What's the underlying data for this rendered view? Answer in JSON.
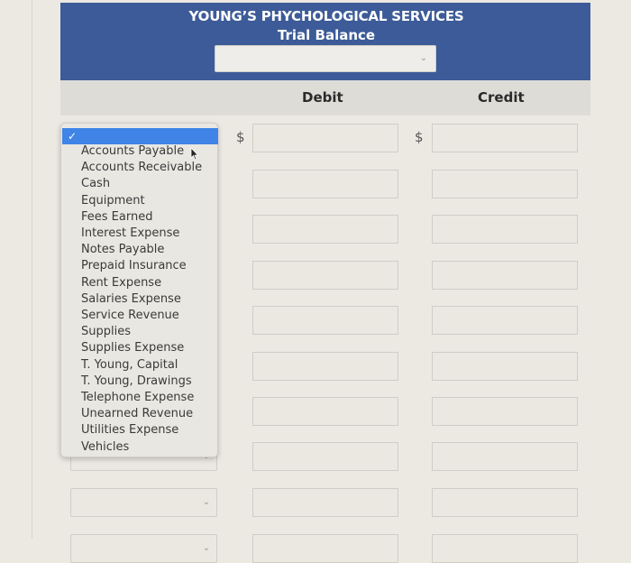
{
  "header": {
    "title": "YOUNG’S PHYCHOLOGICAL SERVICES",
    "subtitle": "Trial Balance",
    "date_select": {
      "value": "",
      "icon": "chevron-down-icon"
    },
    "background_color": "#3c5b98"
  },
  "columns": {
    "debit": "Debit",
    "credit": "Credit"
  },
  "currency_symbol": "$",
  "dropdown": {
    "open": true,
    "selected_label": "",
    "selected_icon": "checkmark-icon",
    "highlight_color": "#3f84e6",
    "options": [
      "Accounts Payable",
      "Accounts Receivable",
      "Cash",
      "Equipment",
      "Fees Earned",
      "Interest Expense",
      "Notes Payable",
      "Prepaid Insurance",
      "Rent Expense",
      "Salaries Expense",
      "Service Revenue",
      "Supplies",
      "Supplies Expense",
      "T. Young, Capital",
      "T. Young, Drawings",
      "Telephone Expense",
      "Unearned Revenue",
      "Utilities Expense",
      "Vehicles"
    ]
  },
  "rows": [
    {
      "account": "",
      "debit": "",
      "credit": "",
      "show_dollar": true
    },
    {
      "account": "",
      "debit": "",
      "credit": "",
      "show_dollar": false
    },
    {
      "account": "",
      "debit": "",
      "credit": "",
      "show_dollar": false
    },
    {
      "account": "",
      "debit": "",
      "credit": "",
      "show_dollar": false
    },
    {
      "account": "",
      "debit": "",
      "credit": "",
      "show_dollar": false
    },
    {
      "account": "",
      "debit": "",
      "credit": "",
      "show_dollar": false
    },
    {
      "account": "",
      "debit": "",
      "credit": "",
      "show_dollar": false
    },
    {
      "account": "",
      "debit": "",
      "credit": "",
      "show_dollar": false
    },
    {
      "account": "",
      "debit": "",
      "credit": "",
      "show_dollar": false
    },
    {
      "account": "",
      "debit": "",
      "credit": "",
      "show_dollar": false
    }
  ]
}
